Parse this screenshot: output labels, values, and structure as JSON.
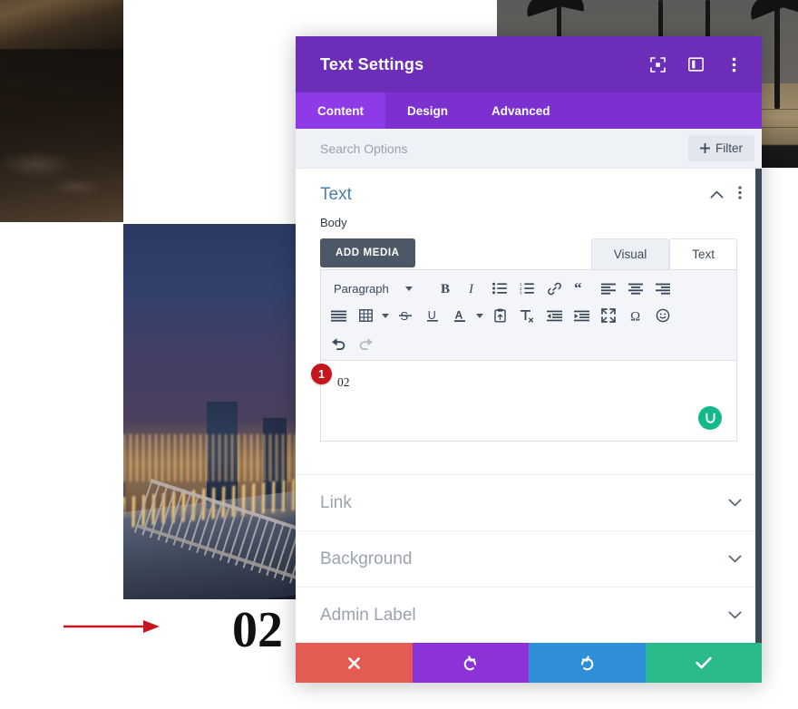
{
  "background": {
    "caption_number": "02",
    "photos": [
      {
        "name": "mountain-lake-photo"
      },
      {
        "name": "palm-trees-photo"
      },
      {
        "name": "night-cityscape-photo"
      }
    ]
  },
  "annotations": {
    "step_badge": "1",
    "arrow": "red-arrow-pointing-right"
  },
  "modal": {
    "title": "Text Settings",
    "header_icons": [
      {
        "name": "expand-view-icon"
      },
      {
        "name": "layout-columns-icon"
      },
      {
        "name": "more-options-icon"
      }
    ],
    "tabs": [
      {
        "label": "Content",
        "active": true
      },
      {
        "label": "Design",
        "active": false
      },
      {
        "label": "Advanced",
        "active": false
      }
    ],
    "search": {
      "placeholder": "Search Options",
      "value": "",
      "filter_label": "Filter"
    },
    "section": {
      "title": "Text",
      "collapse_icon": "chevron-up-icon",
      "menu_icon": "more-options-icon"
    },
    "body_field": {
      "label": "Body",
      "add_media_label": "ADD MEDIA",
      "editor_tabs": [
        {
          "label": "Visual",
          "active": true
        },
        {
          "label": "Text",
          "active": false
        }
      ],
      "format_select": "Paragraph",
      "toolbar_row1": [
        "bold-icon",
        "italic-icon",
        "bulleted-list-icon",
        "numbered-list-icon",
        "link-icon",
        "blockquote-icon",
        "align-left-icon",
        "align-center-icon",
        "align-right-icon"
      ],
      "toolbar_row2": [
        "align-justify-icon",
        "table-icon",
        "strikethrough-icon",
        "underline-icon",
        "text-color-icon",
        "paste-as-text-icon",
        "clear-formatting-icon",
        "outdent-icon",
        "indent-icon",
        "fullscreen-icon",
        "special-character-icon",
        "emoji-icon"
      ],
      "toolbar_row3": [
        "undo-icon",
        "redo-icon"
      ],
      "content": "02",
      "assistant_indicator": "grammar-check-spinner"
    },
    "accordions": [
      {
        "label": "Link"
      },
      {
        "label": "Background"
      },
      {
        "label": "Admin Label"
      }
    ],
    "footer_buttons": [
      {
        "name": "cancel-button",
        "icon": "close-icon",
        "color": "#e35b53"
      },
      {
        "name": "undo-button",
        "icon": "undo-icon",
        "color": "#8b33d6"
      },
      {
        "name": "redo-button",
        "icon": "redo-icon",
        "color": "#2f8fd8"
      },
      {
        "name": "save-button",
        "icon": "check-icon",
        "color": "#2ab98a"
      }
    ]
  },
  "colors": {
    "header_purple": "#6c2eb9",
    "tabs_purple": "#7b30cf",
    "tab_active_purple": "#8e3ae8",
    "section_title_blue": "#4c7fa8",
    "badge_red": "#c4161c",
    "green_accent": "#15b88a"
  }
}
